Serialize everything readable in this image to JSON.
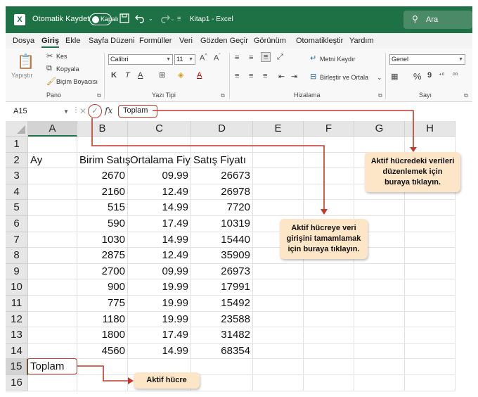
{
  "titlebar": {
    "app_icon": "X",
    "autosave_label": "Otomatik Kaydet",
    "autosave_state": "Kapalı",
    "save_icon": "save-icon",
    "undo_icon": "undo-icon",
    "redo_icon": "redo-icon",
    "title": "Kitap1  -  Excel",
    "search_placeholder": "Ara"
  },
  "menu": {
    "tabs": [
      "Dosya",
      "Giriş",
      "Ekle",
      "Sayfa Düzeni",
      "Formüller",
      "Veri",
      "Gözden Geçir",
      "Görünüm",
      "Otomatikleştir",
      "Yardım"
    ],
    "active": "Giriş"
  },
  "ribbon": {
    "clipboard": {
      "paste": "Yapıştır",
      "cut": "Kes",
      "copy": "Kopyala",
      "format_painter": "Biçim Boyacısı",
      "group": "Pano"
    },
    "font": {
      "name": "Calibri",
      "size": "11",
      "bold": "K",
      "italic": "T",
      "underline": "A",
      "group": "Yazı Tipi"
    },
    "alignment": {
      "wrap": "Metni Kaydır",
      "merge": "Birleştir ve Ortala",
      "group": "Hizalama"
    },
    "number": {
      "format": "Genel",
      "percent": "%",
      "comma": "9",
      "group": "Sayı"
    }
  },
  "formula_bar": {
    "name_box": "A15",
    "content": "Toplam",
    "fx": "fx"
  },
  "sheet": {
    "columns": [
      "A",
      "B",
      "C",
      "D",
      "E",
      "F",
      "G",
      "H"
    ],
    "rows": [
      {
        "num": "1",
        "cells": [
          "",
          "",
          "",
          ""
        ]
      },
      {
        "num": "2",
        "cells": [
          "Ay",
          "Birim Satış",
          "Ortalama Fiyat",
          "Satış Fiyatı"
        ]
      },
      {
        "num": "3",
        "cells": [
          "",
          "2670",
          "09.99",
          "26673"
        ]
      },
      {
        "num": "4",
        "cells": [
          "",
          "2160",
          "12.49",
          "26978"
        ]
      },
      {
        "num": "5",
        "cells": [
          "",
          "515",
          "14.99",
          "7720"
        ]
      },
      {
        "num": "6",
        "cells": [
          "",
          "590",
          "17.49",
          "10319"
        ]
      },
      {
        "num": "7",
        "cells": [
          "",
          "1030",
          "14.99",
          "15440"
        ]
      },
      {
        "num": "8",
        "cells": [
          "",
          "2875",
          "12.49",
          "35909"
        ]
      },
      {
        "num": "9",
        "cells": [
          "",
          "2700",
          "09.99",
          "26973"
        ]
      },
      {
        "num": "10",
        "cells": [
          "",
          "900",
          "19.99",
          "17991"
        ]
      },
      {
        "num": "11",
        "cells": [
          "",
          "775",
          "19.99",
          "15492"
        ]
      },
      {
        "num": "12",
        "cells": [
          "",
          "1180",
          "19.99",
          "23588"
        ]
      },
      {
        "num": "13",
        "cells": [
          "",
          "1800",
          "17.49",
          "31482"
        ]
      },
      {
        "num": "14",
        "cells": [
          "",
          "4560",
          "14.99",
          "68354"
        ]
      },
      {
        "num": "15",
        "cells": [
          "Toplam",
          "",
          "",
          ""
        ]
      },
      {
        "num": "16",
        "cells": [
          "",
          "",
          "",
          ""
        ]
      }
    ],
    "active_cell": "A15"
  },
  "callouts": {
    "edit": "Aktif hücredeki verileri düzenlemek için buraya tıklayın.",
    "enter": "Aktif hücreye veri girişini tamamlamak için buraya tıklayın.",
    "active": "Aktif hücre"
  },
  "colors": {
    "accent": "#1e7145",
    "callout_bg": "#fde6c7",
    "callout_line": "#c0392b"
  }
}
